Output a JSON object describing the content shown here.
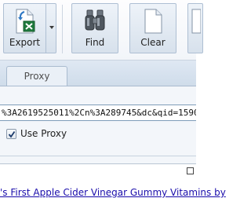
{
  "ribbon": {
    "export_label": "Export",
    "find_label": "Find",
    "clear_label": "Clear"
  },
  "tabs": [
    {
      "label": "Proxy"
    }
  ],
  "url_field": {
    "value": "%3A2619525011%2Cn%3A289745&dc&qid=1590"
  },
  "use_proxy": {
    "label": "Use Proxy",
    "checked": true
  },
  "result": {
    "link_text": "'s First Apple Cider Vinegar Gummy Vitamins by"
  },
  "colors": {
    "link": "#1a0dab",
    "excel_green": "#1f7a3d"
  }
}
